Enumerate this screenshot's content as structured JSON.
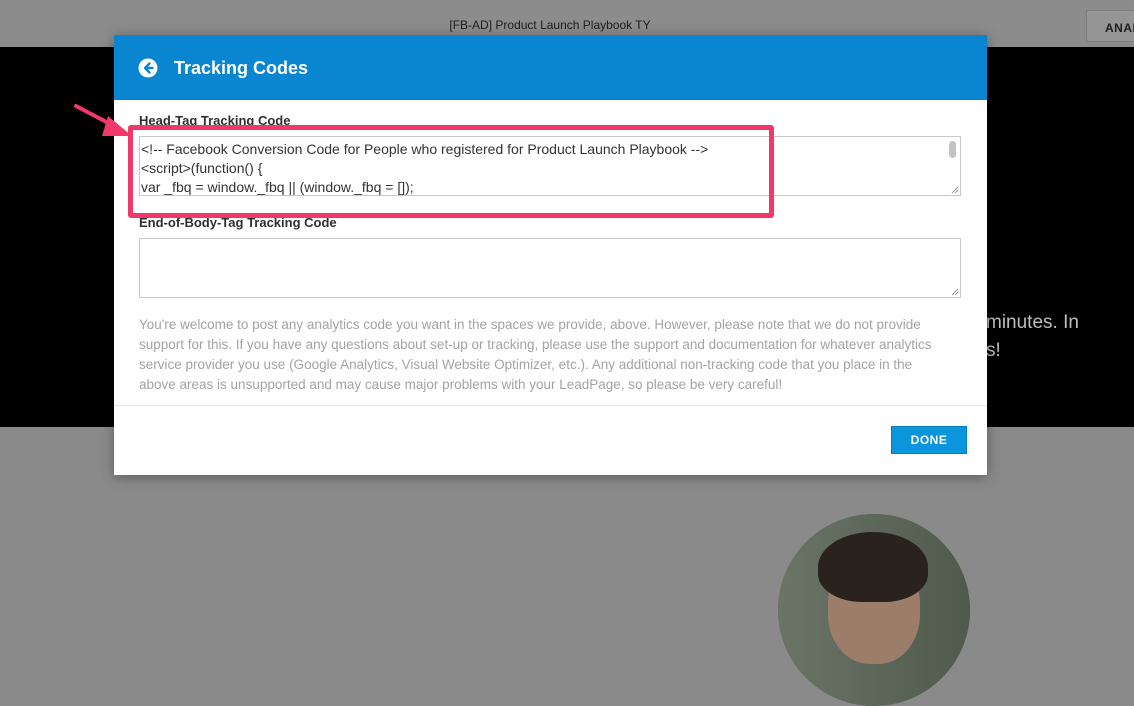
{
  "page": {
    "title": "[FB-AD] Product Launch Playbook TY",
    "analytics_label": "ANALYTICS",
    "hero_line1": "minutes. In",
    "hero_line2": "s!"
  },
  "modal": {
    "title": "Tracking Codes",
    "back_icon": "arrow-left-circle-icon",
    "head_label": "Head-Tag Tracking Code",
    "head_code": [
      "<!-- Facebook Conversion Code for People who registered for Product Launch Playbook -->",
      "<script>(function() {",
      "var _fbq = window._fbq || (window._fbq = []);"
    ],
    "body_label": "End-of-Body-Tag Tracking Code",
    "body_code": "",
    "note": "You're welcome to post any analytics code you want in the spaces we provide, above. However, please note that we do not provide support for this. If you have any questions about set-up or tracking, please use the support and documentation for whatever analytics service provider you use (Google Analytics, Visual Website Optimizer, etc.). Any additional non-tracking code that you place in the above areas is unsupported and may cause major problems with your LeadPage, so please be very careful!",
    "done_label": "DONE"
  },
  "colors": {
    "header_blue": "#0a85cf",
    "done_blue": "#0a95dc",
    "highlight_pink": "#f0386b"
  }
}
